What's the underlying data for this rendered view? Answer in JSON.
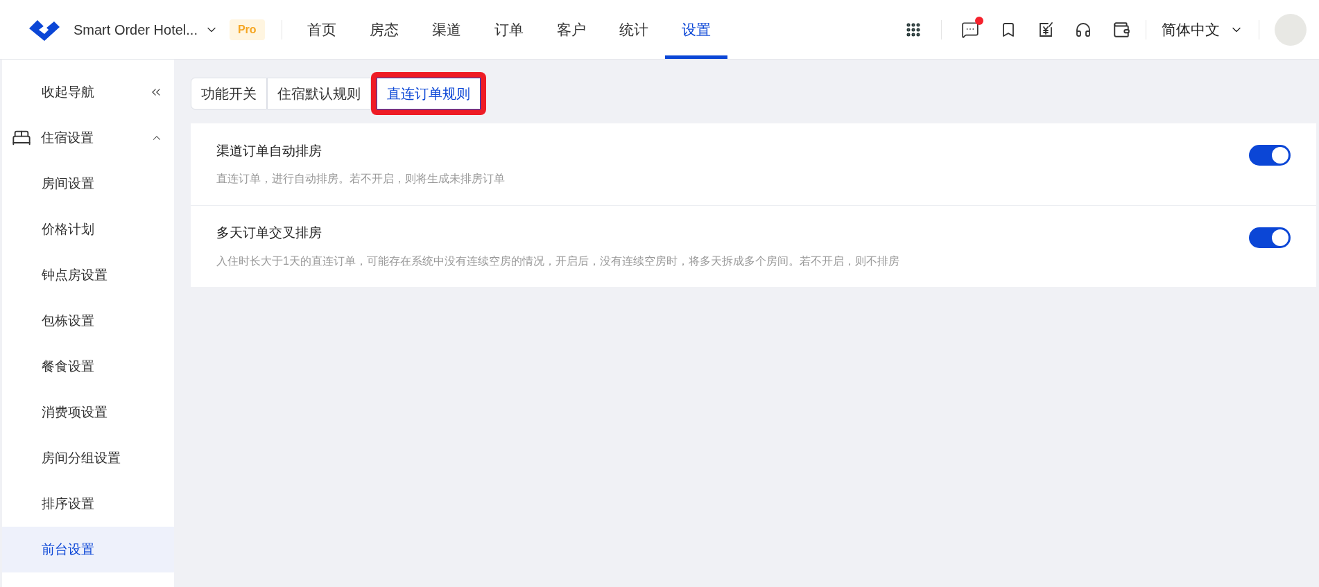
{
  "header": {
    "hotel_name": "Smart Order Hotel...",
    "plan_badge": "Pro",
    "nav": [
      {
        "label": "首页",
        "selected": false
      },
      {
        "label": "房态",
        "selected": false
      },
      {
        "label": "渠道",
        "selected": false
      },
      {
        "label": "订单",
        "selected": false
      },
      {
        "label": "客户",
        "selected": false
      },
      {
        "label": "统计",
        "selected": false
      },
      {
        "label": "设置",
        "selected": true
      }
    ],
    "has_message_dot": true,
    "language": "简体中文"
  },
  "sidebar": {
    "collapse_label": "收起导航",
    "group": {
      "label": "住宿设置",
      "expanded": true,
      "children": [
        {
          "label": "房间设置",
          "selected": false
        },
        {
          "label": "价格计划",
          "selected": false
        },
        {
          "label": "钟点房设置",
          "selected": false
        },
        {
          "label": "包栋设置",
          "selected": false
        },
        {
          "label": "餐食设置",
          "selected": false
        },
        {
          "label": "消费项设置",
          "selected": false
        },
        {
          "label": "房间分组设置",
          "selected": false
        },
        {
          "label": "排序设置",
          "selected": false
        },
        {
          "label": "前台设置",
          "selected": true
        }
      ]
    }
  },
  "tabs": [
    {
      "label": "功能开关",
      "selected": false,
      "highlighted": false
    },
    {
      "label": "住宿默认规则",
      "selected": false,
      "highlighted": false
    },
    {
      "label": "直连订单规则",
      "selected": true,
      "highlighted": true
    }
  ],
  "settings": [
    {
      "title": "渠道订单自动排房",
      "description": "直连订单，进行自动排房。若不开启，则将生成未排房订单",
      "on": true
    },
    {
      "title": "多天订单交叉排房",
      "description": "入住时长大于1天的直连订单，可能存在系统中没有连续空房的情况，开启后，没有连续空房时，将多天拆成多个房间。若不开启，则不排房",
      "on": true
    }
  ]
}
